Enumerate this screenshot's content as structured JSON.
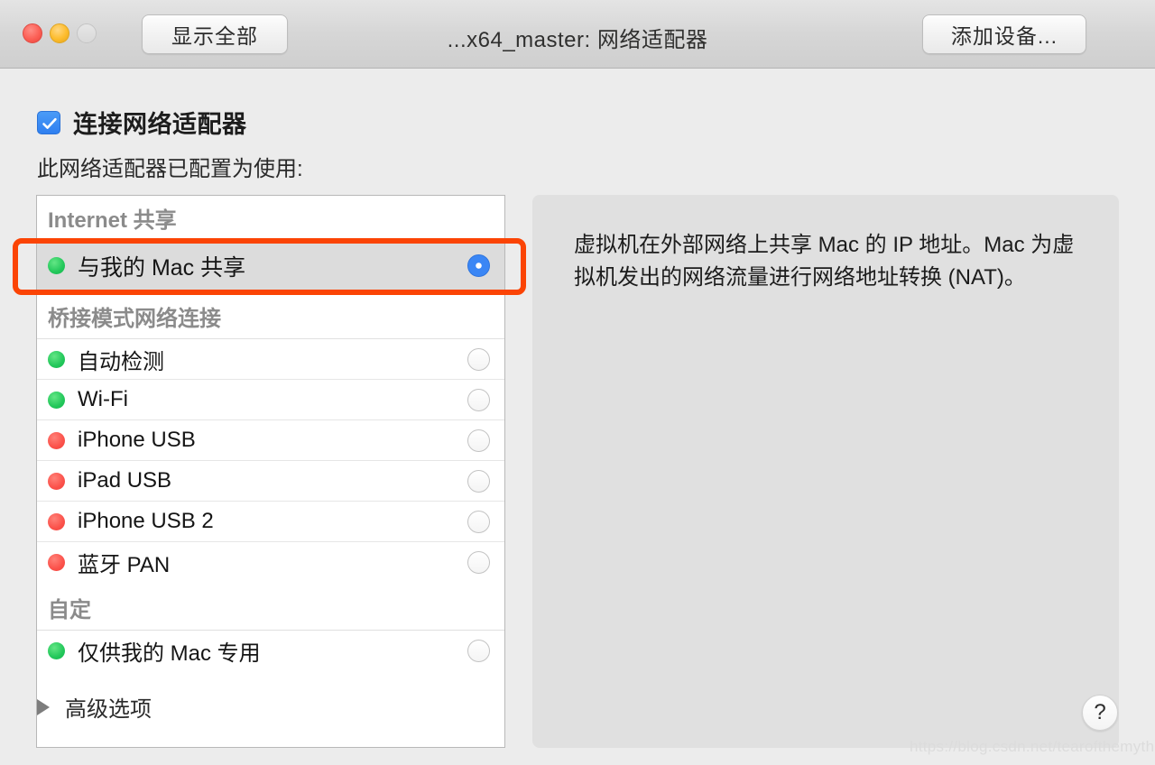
{
  "titlebar": {
    "show_all_label": "显示全部",
    "title": "...x64_master: 网络适配器",
    "add_device_label": "添加设备...",
    "traffic_lights": [
      "close",
      "minimize",
      "zoom"
    ]
  },
  "body": {
    "connect_checkbox_label": "连接网络适配器",
    "connect_checkbox_checked": true,
    "configured_label": "此网络适配器已配置为使用:"
  },
  "list": {
    "groups": [
      {
        "header": "Internet 共享",
        "items": [
          {
            "label": "与我的 Mac 共享",
            "status": "green",
            "selected": true
          }
        ]
      },
      {
        "header": "桥接模式网络连接",
        "items": [
          {
            "label": "自动检测",
            "status": "green",
            "selected": false
          },
          {
            "label": "Wi-Fi",
            "status": "green",
            "selected": false
          },
          {
            "label": "iPhone USB",
            "status": "red",
            "selected": false
          },
          {
            "label": "iPad USB",
            "status": "red",
            "selected": false
          },
          {
            "label": "iPhone USB 2",
            "status": "red",
            "selected": false
          },
          {
            "label": "蓝牙 PAN",
            "status": "red",
            "selected": false
          }
        ]
      },
      {
        "header": "自定",
        "items": [
          {
            "label": "仅供我的 Mac 专用",
            "status": "green",
            "selected": false
          }
        ]
      }
    ]
  },
  "description": {
    "text": "虚拟机在外部网络上共享 Mac 的 IP 地址。Mac 为虚拟机发出的网络流量进行网络地址转换 (NAT)。"
  },
  "footer": {
    "advanced_label": "高级选项",
    "advanced_expanded": false,
    "help_label": "?"
  },
  "annotation": {
    "color": "#fb4405",
    "target": "与我的 Mac 共享"
  },
  "watermark": {
    "text": "https://blog.csdn.net/tearofthemyth"
  }
}
